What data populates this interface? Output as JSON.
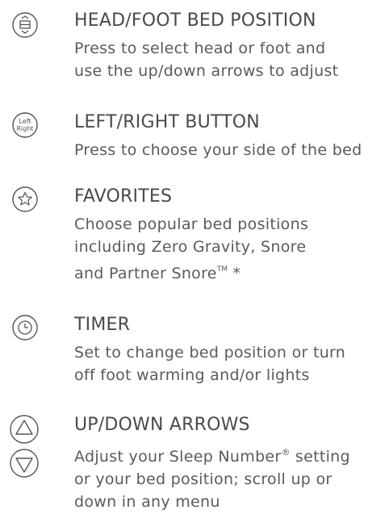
{
  "items": [
    {
      "icon": "head-foot-toggle-icon",
      "title": "HEAD/FOOT BED POSITION",
      "lines": [
        "Press to select head or foot and",
        "use the up/down arrows to adjust"
      ]
    },
    {
      "icon": "left-right-icon",
      "icon_text_top": "Left",
      "icon_text_bottom": "Right",
      "title": "LEFT/RIGHT BUTTON",
      "lines": [
        "Press to choose your side of the bed"
      ]
    },
    {
      "icon": "star-icon",
      "title": "FAVORITES",
      "lines": [
        "Choose popular bed positions",
        "including Zero Gravity, Snore",
        "and Partner Snore"
      ],
      "line3_tm": "TM",
      "line3_suffix": " *"
    },
    {
      "icon": "clock-icon",
      "title": "TIMER",
      "lines": [
        "Set to change bed position or turn",
        "off foot warming and/or lights"
      ]
    },
    {
      "icon": "up-down-arrows-icon",
      "title": "UP/DOWN ARROWS",
      "lines": [
        "Adjust your Sleep Number",
        "or your bed position; scroll up or",
        "down in any menu"
      ],
      "line1_reg": "®",
      "line1_suffix": " setting"
    }
  ],
  "colors": {
    "text": "#4d4d4d",
    "icon_stroke": "#555555"
  }
}
